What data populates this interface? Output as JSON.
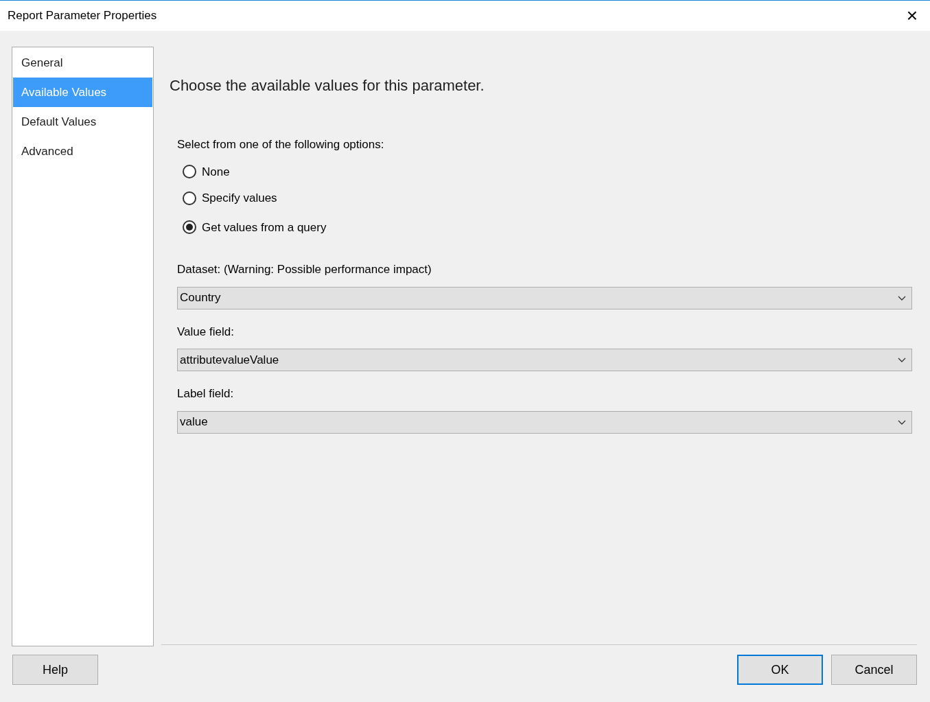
{
  "window": {
    "title": "Report Parameter Properties",
    "close": "×"
  },
  "sidebar": {
    "items": [
      {
        "label": "General",
        "selected": false
      },
      {
        "label": "Available Values",
        "selected": true
      },
      {
        "label": "Default Values",
        "selected": false
      },
      {
        "label": "Advanced",
        "selected": false
      }
    ]
  },
  "heading": "Choose the available values for this parameter.",
  "options_label": "Select from one of the following options:",
  "options": [
    {
      "label": "None",
      "selected": false
    },
    {
      "label": "Specify values",
      "selected": false
    },
    {
      "label": "Get values from a query",
      "selected": true
    }
  ],
  "fields": [
    {
      "label": "Dataset: (Warning: Possible performance impact)",
      "value": "Country"
    },
    {
      "label": "Value field:",
      "value": "attributevalueValue"
    },
    {
      "label": "Label field:",
      "value": "value"
    }
  ],
  "buttons": {
    "help": "Help",
    "ok": "OK",
    "cancel": "Cancel"
  }
}
